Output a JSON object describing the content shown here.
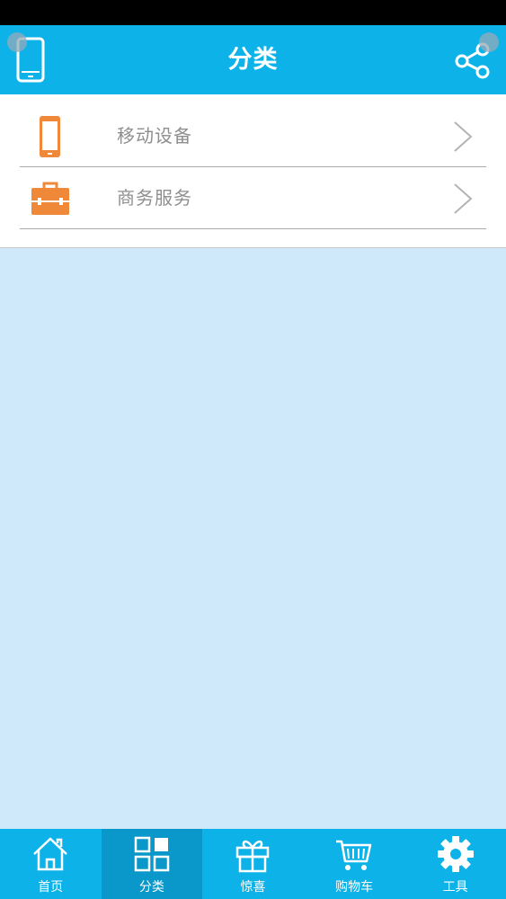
{
  "header": {
    "title": "分类",
    "left_icon": "phone-icon",
    "right_icon": "share-icon"
  },
  "categories": [
    {
      "label": "移动设备",
      "icon": "mobile-device-icon",
      "color": "#f0883a"
    },
    {
      "label": "商务服务",
      "icon": "briefcase-icon",
      "color": "#f0883a"
    }
  ],
  "tabs": [
    {
      "label": "首页",
      "icon": "home-icon",
      "active": false
    },
    {
      "label": "分类",
      "icon": "grid-icon",
      "active": true
    },
    {
      "label": "惊喜",
      "icon": "gift-icon",
      "active": false
    },
    {
      "label": "购物车",
      "icon": "cart-icon",
      "active": false
    },
    {
      "label": "工具",
      "icon": "gear-icon",
      "active": false
    }
  ],
  "colors": {
    "primary": "#0db3e8",
    "active_tab": "#0a97c9",
    "background": "#cfe9fa",
    "accent": "#f0883a"
  }
}
